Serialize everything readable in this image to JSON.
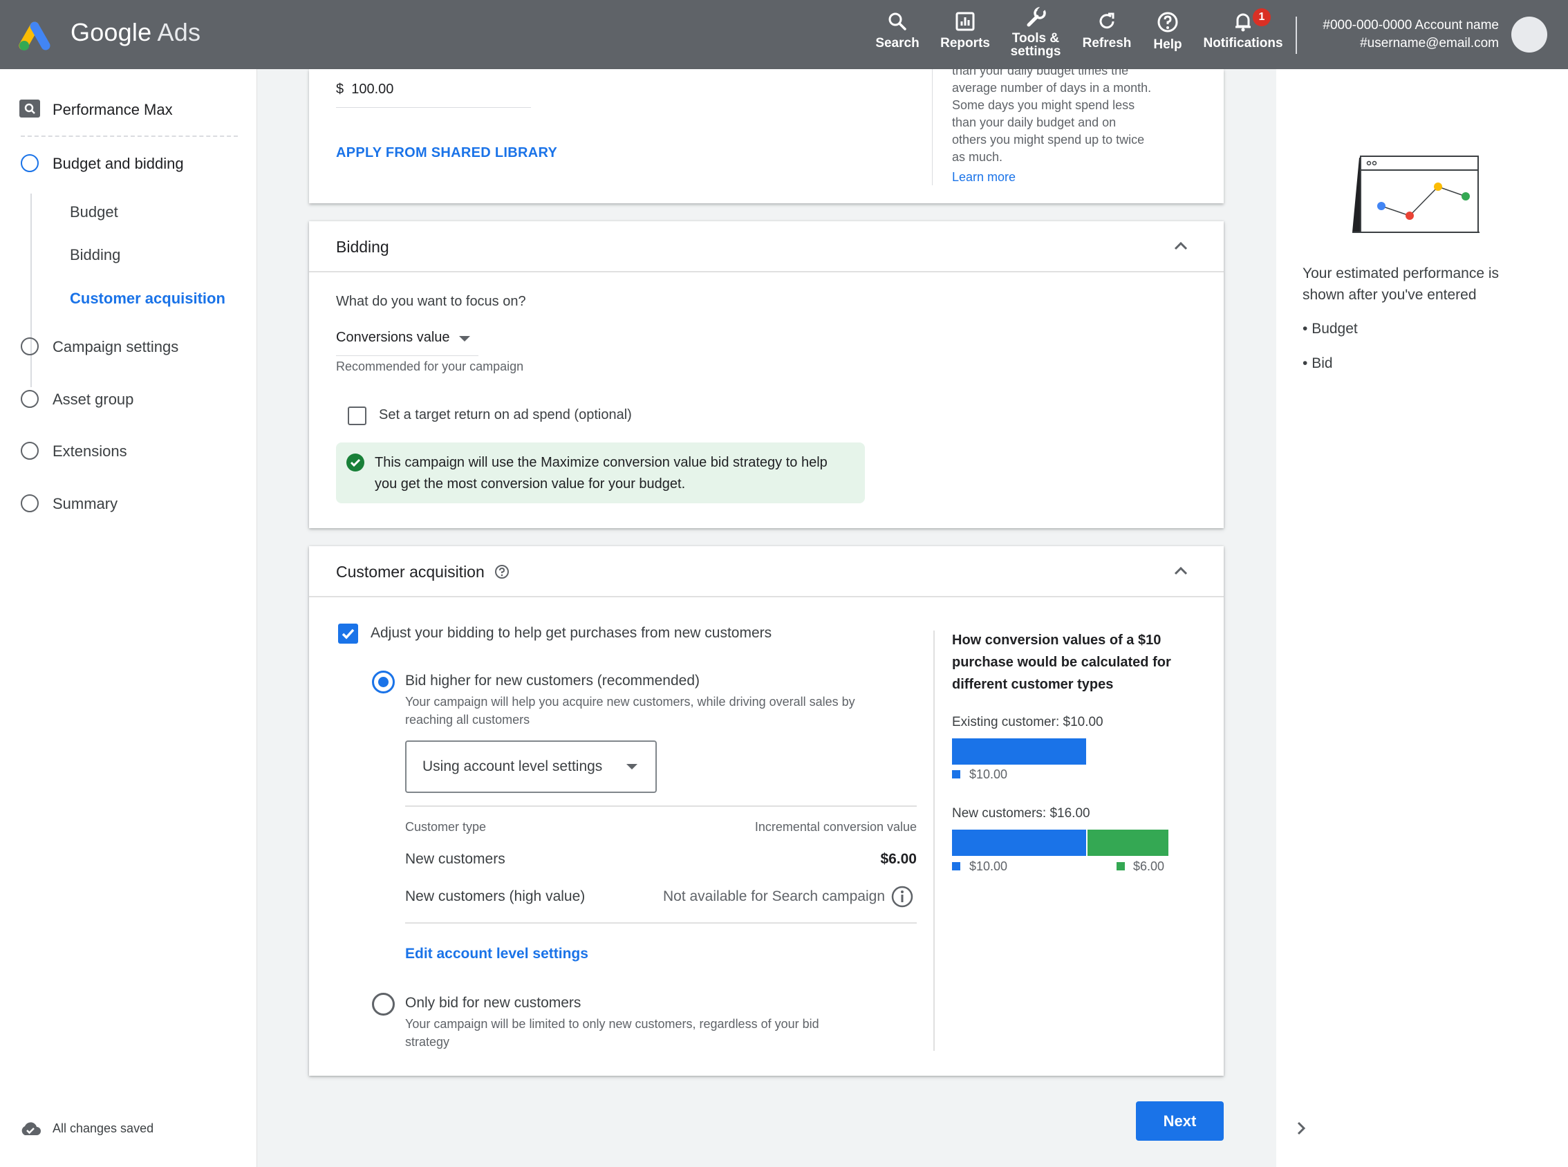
{
  "header": {
    "brand_google": "Google",
    "brand_ads": "Ads",
    "nav": [
      {
        "label": "Search",
        "icon": "search-icon"
      },
      {
        "label": "Reports",
        "icon": "reports-icon"
      },
      {
        "label": "Tools &",
        "label2": "settings",
        "icon": "wrench-icon"
      },
      {
        "label": "Refresh",
        "icon": "refresh-icon"
      },
      {
        "label": "Help",
        "icon": "help-icon"
      },
      {
        "label": "Notifications",
        "icon": "bell-icon",
        "badge": "1"
      }
    ],
    "account_line1": "#000-000-0000 Account name",
    "account_line2": "#username@email.com"
  },
  "sidebar": {
    "campaign_type": "Performance Max",
    "items": [
      {
        "label": "Budget and bidding",
        "active": true
      },
      {
        "label": "Campaign settings"
      },
      {
        "label": "Asset group"
      },
      {
        "label": "Extensions"
      },
      {
        "label": "Summary"
      }
    ],
    "subitems": [
      {
        "label": "Budget"
      },
      {
        "label": "Bidding"
      },
      {
        "label": "Customer acquisition",
        "active": true
      }
    ],
    "saved_status": "All changes saved"
  },
  "budget_card": {
    "currency": "$",
    "amount": "100.00",
    "shared_library_link": "APPLY FROM SHARED LIBRARY",
    "help_lines": [
      "than your daily budget times the",
      "average number of days in a month.",
      "Some days you might spend less",
      "than your daily budget and on",
      "others you might spend up to twice",
      "as much."
    ],
    "learn_more": "Learn more"
  },
  "bidding_card": {
    "title": "Bidding",
    "question": "What do you want to focus on?",
    "focus_value": "Conversions value",
    "focus_hint": "Recommended for your campaign",
    "target_roas_label": "Set a target return on ad spend (optional)",
    "info_line1": "This campaign will use the Maximize conversion value bid strategy to help",
    "info_line2": "you get the most conversion value for your budget."
  },
  "acquisition_card": {
    "title": "Customer acquisition",
    "adjust_label": "Adjust your bidding to help get purchases from new customers",
    "option1_title": "Bid higher for new customers (recommended)",
    "option1_desc1": "Your campaign will help you acquire new customers, while driving overall sales by",
    "option1_desc2": "reaching all customers",
    "settings_dropdown": "Using account level settings",
    "table_header_type": "Customer type",
    "table_header_value": "Incremental conversion value",
    "rows": [
      {
        "type": "New customers",
        "value": "$6.00"
      },
      {
        "type": "New customers (high value)",
        "value": "Not available for Search campaign"
      }
    ],
    "edit_link": "Edit account level settings",
    "option2_title": "Only bid for new customers",
    "option2_desc1": "Your campaign will be limited to only new customers, regardless of your bid",
    "option2_desc2": "strategy",
    "explainer_line1": "How conversion values of a $10",
    "explainer_line2": "purchase would be calculated for",
    "explainer_line3": "different customer types",
    "existing_label": "Existing customer: $10.00",
    "existing_legend": "$10.00",
    "new_label": "New customers: $16.00",
    "new_legend_base": "$10.00",
    "new_legend_extra": "$6.00",
    "chart": {
      "existing_base": 10,
      "new_base": 10,
      "new_extra": 6,
      "max": 16
    },
    "colors": {
      "base": "#1a73e8",
      "extra": "#34a853"
    }
  },
  "right_panel": {
    "line1": "Your estimated performance is",
    "line2": "shown after you've entered",
    "bullets": [
      "Budget",
      "Bid"
    ]
  },
  "footer": {
    "next_label": "Next"
  }
}
